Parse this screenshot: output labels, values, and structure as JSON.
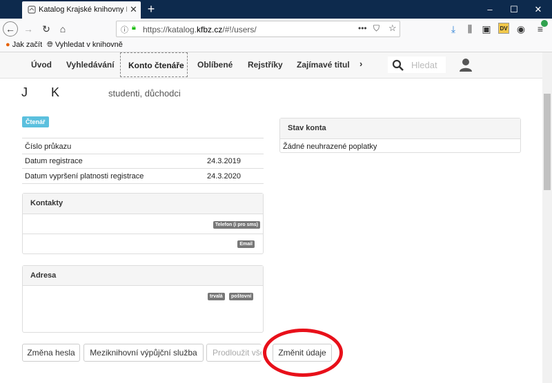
{
  "browser": {
    "tab_title": "Katalog Krajské knihovny Franti",
    "new_tab": "+",
    "url_prefix": "https://katalog.",
    "url_domain": "kfbz.cz",
    "url_path": "/#!/users/",
    "bookmarks": [
      "Jak začít",
      "Vyhledat v knihovně"
    ],
    "window_controls": [
      "–",
      "☐",
      "✕"
    ],
    "ext_label": "DV"
  },
  "menu": {
    "items": [
      "Úvod",
      "Vyhledávání",
      "Konto čtenáře",
      "Oblíbené",
      "Rejstříky",
      "Zajímavé titul"
    ],
    "search_placeholder": "Hledat"
  },
  "user": {
    "initial_first": "J",
    "initial_last": "K",
    "category": "studenti, důchodci",
    "role_badge": "Čtenář"
  },
  "info_rows": [
    {
      "label": "Číslo průkazu",
      "value": ""
    },
    {
      "label": "Datum registrace",
      "value": "24.3.2019"
    },
    {
      "label": "Datum vypršení platnosti registrace",
      "value": "24.3.2020"
    }
  ],
  "contacts": {
    "title": "Kontakty",
    "phone_badge": "Telefon (i pro sms)",
    "email_badge": "Email"
  },
  "address": {
    "title": "Adresa",
    "badges": [
      "trvalá",
      "poštovní"
    ]
  },
  "account": {
    "title": "Stav konta",
    "status": "Žádné neuhrazené poplatky"
  },
  "buttons": {
    "change_password": "Změna hesla",
    "ill_service": "Meziknihovní výpůjční služba",
    "extend_all": "Prodloužit vše",
    "change_details": "Změnit údaje"
  },
  "colors": {
    "badge_info": "#5bc0de",
    "highlight_ring": "#e8101a",
    "titlebar": "#0d2a4d"
  }
}
